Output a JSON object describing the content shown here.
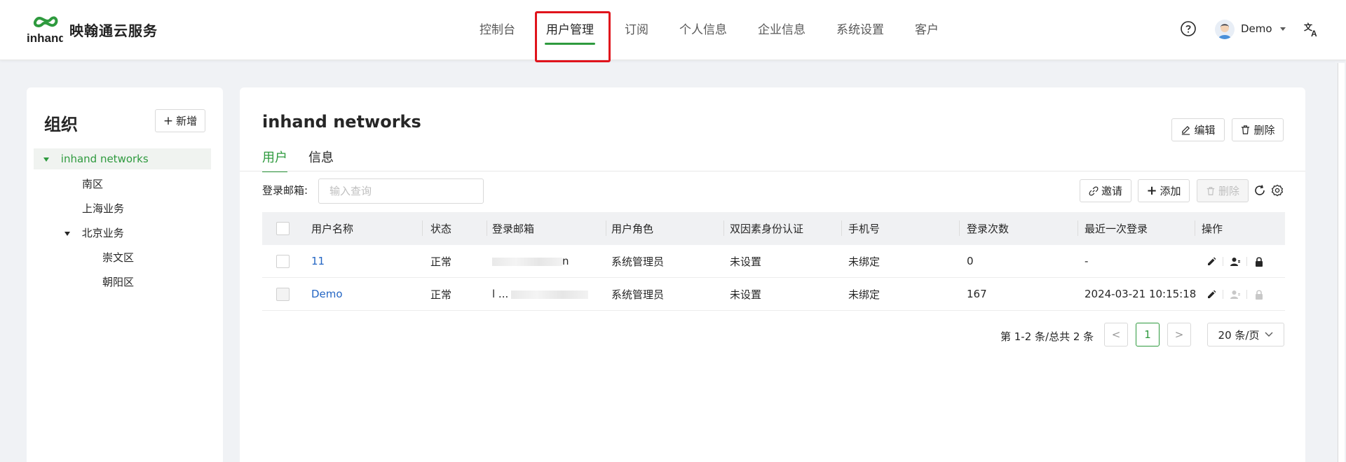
{
  "header": {
    "brand": "映翰通云服务",
    "logo_text": "inhand",
    "nav": [
      "控制台",
      "用户管理",
      "订阅",
      "个人信息",
      "企业信息",
      "系统设置",
      "客户"
    ],
    "active_nav": "用户管理",
    "user": "Demo",
    "accent": "#2e9a3e",
    "highlight_color": "#e0141c"
  },
  "sidebar": {
    "title": "组织",
    "new_button": "新增",
    "tree": [
      {
        "label": "inhand networks",
        "level": 0,
        "expanded": true,
        "selected": true
      },
      {
        "label": "南区",
        "level": 1
      },
      {
        "label": "上海业务",
        "level": 1
      },
      {
        "label": "北京业务",
        "level": 1,
        "expanded": true
      },
      {
        "label": "崇文区",
        "level": 2
      },
      {
        "label": "朝阳区",
        "level": 2
      }
    ]
  },
  "main": {
    "title": "inhand networks",
    "edit_button": "编辑",
    "delete_button": "删除",
    "tabs": [
      "用户",
      "信息"
    ],
    "active_tab": "用户",
    "filter_label": "登录邮箱:",
    "filter_placeholder": "输入查询",
    "invite_button": "邀请",
    "add_button": "添加",
    "remove_button": "删除",
    "columns": [
      "用户名称",
      "状态",
      "登录邮箱",
      "用户角色",
      "双因素身份认证",
      "手机号",
      "登录次数",
      "最近一次登录",
      "操作"
    ],
    "rows": [
      {
        "name": "11",
        "status": "正常",
        "email": "n",
        "role": "系统管理员",
        "two_factor": "未设置",
        "phone": "未绑定",
        "login_count": "0",
        "last_login": "-"
      },
      {
        "name": "Demo",
        "status": "正常",
        "email": "l ...",
        "role": "系统管理员",
        "two_factor": "未设置",
        "phone": "未绑定",
        "login_count": "167",
        "last_login": "2024-03-21 10:15:18"
      }
    ],
    "pagination": {
      "total": "第 1-2 条/总共 2 条",
      "current_page": "1",
      "prev": "<",
      "next": ">",
      "page_size": "20 条/页"
    }
  }
}
